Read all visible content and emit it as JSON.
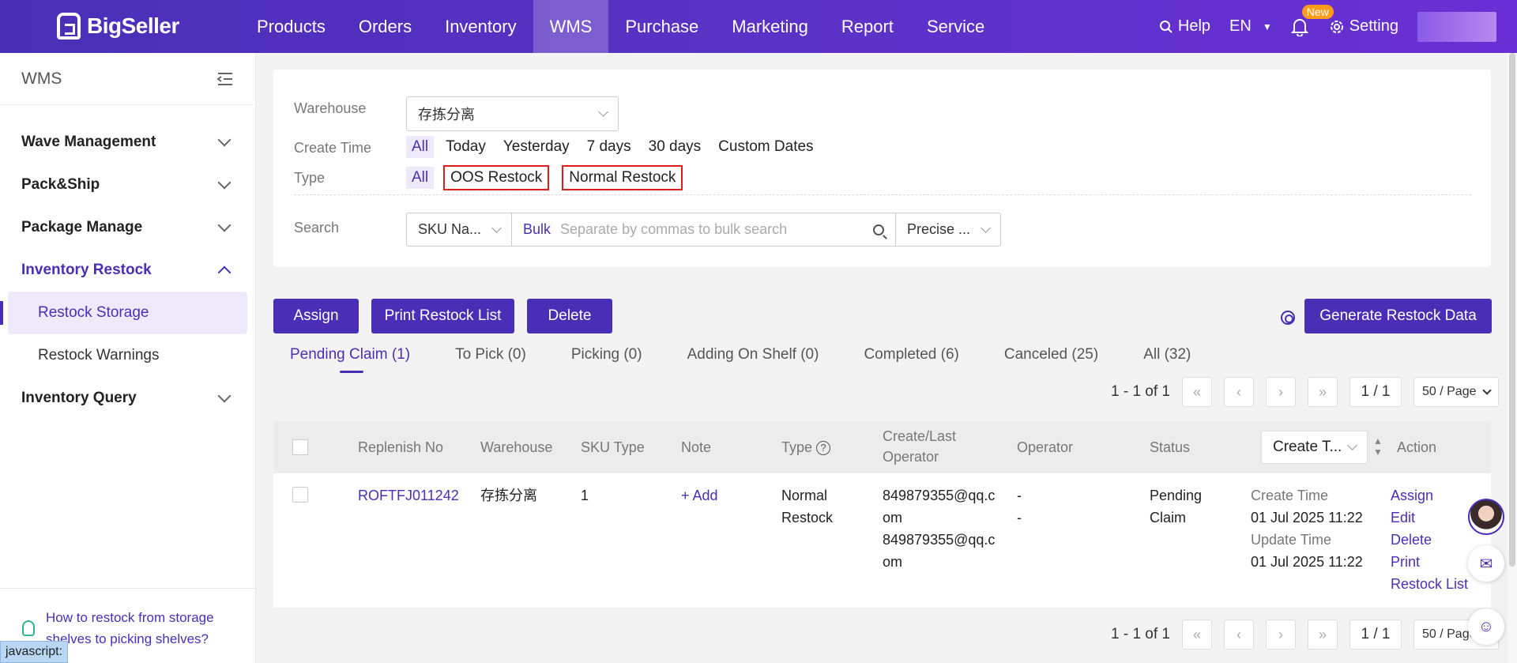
{
  "brand": {
    "name": "BigSeller"
  },
  "nav": {
    "items": [
      "Products",
      "Orders",
      "Inventory",
      "WMS",
      "Purchase",
      "Marketing",
      "Report",
      "Service"
    ],
    "active": "WMS"
  },
  "top_right": {
    "help": "Help",
    "language": "EN",
    "new_badge": "New",
    "setting": "Setting"
  },
  "sidebar": {
    "title": "WMS",
    "items": [
      {
        "label": "Wave Management"
      },
      {
        "label": "Pack&Ship"
      },
      {
        "label": "Package Manage"
      },
      {
        "label": "Inventory Restock"
      },
      {
        "label": "Inventory Query"
      }
    ],
    "sub_items": [
      "Restock Storage",
      "Restock Warnings"
    ],
    "active_sub": "Restock Storage",
    "help_link": "How to restock from storage shelves to picking shelves?"
  },
  "status_bar": "javascript:",
  "filters": {
    "warehouse_label": "Warehouse",
    "warehouse_value": "存拣分离",
    "create_time_label": "Create Time",
    "create_time_options": [
      "All",
      "Today",
      "Yesterday",
      "7 days",
      "30 days",
      "Custom Dates"
    ],
    "type_label": "Type",
    "type_options": [
      "All",
      "OOS Restock",
      "Normal Restock"
    ],
    "search_label": "Search",
    "search_field": "SKU Na...",
    "bulk": "Bulk",
    "search_placeholder": "Separate by commas to bulk search",
    "match_mode": "Precise ..."
  },
  "actions": {
    "assign": "Assign",
    "print": "Print Restock List",
    "delete": "Delete",
    "generate": "Generate Restock Data"
  },
  "tabs": [
    "Pending Claim (1)",
    "To Pick (0)",
    "Picking (0)",
    "Adding On Shelf (0)",
    "Completed (6)",
    "Canceled (25)",
    "All (32)"
  ],
  "pagination": {
    "summary": "1 - 1 of 1",
    "page": "1 / 1",
    "page_size": "50 / Page"
  },
  "table": {
    "headers": {
      "replenish_no": "Replenish No",
      "warehouse": "Warehouse",
      "sku_type": "SKU Type",
      "note": "Note",
      "type": "Type",
      "create_last_operator": "Create/Last Operator",
      "operator": "Operator",
      "status": "Status",
      "sort": "Create T...",
      "action": "Action"
    },
    "rows": [
      {
        "replenish_no": "ROFTFJ011242",
        "warehouse": "存拣分离",
        "sku_type": "1",
        "note_add": "+ Add",
        "type": "Normal Restock",
        "creator_1": "849879355@qq.c",
        "creator_1b": "om",
        "creator_2": "849879355@qq.c",
        "creator_2b": "om",
        "operator_1": "-",
        "operator_2": "-",
        "status": "Pending Claim",
        "create_time_label": "Create Time",
        "create_time": "01 Jul 2025 11:22",
        "update_time_label": "Update Time",
        "update_time": "01 Jul 2025 11:22",
        "actions": [
          "Assign",
          "Edit",
          "Delete",
          "Print Restock List"
        ]
      }
    ]
  }
}
